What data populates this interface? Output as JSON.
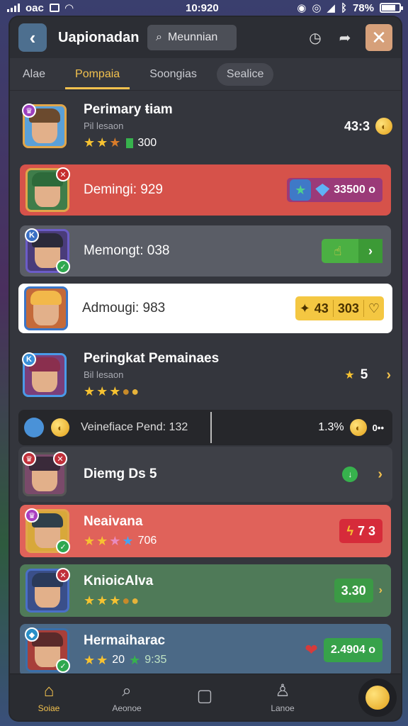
{
  "status_bar": {
    "carrier": "oac",
    "time": "10:920",
    "battery": "78%"
  },
  "header": {
    "title": "Uapionadan",
    "search_placeholder": "Meunnian"
  },
  "tabs": [
    "Alae",
    "Pompaia",
    "Soongias",
    "Sealice"
  ],
  "rows": [
    {
      "name": "Perimary ŧiam",
      "sub": "Pil lesaon",
      "value": "300",
      "right_value": "43:3",
      "rating": 3
    },
    {
      "name": "Demingi: 929",
      "right_value": "33500 o"
    },
    {
      "name": "Memongt: 038"
    },
    {
      "name": "Admougi: 983",
      "value_a": "43",
      "value_b": "303"
    },
    {
      "name": "Peringkat Pemainaes",
      "sub": "Bil lesaon",
      "right_value": "5"
    },
    {
      "name": "Veinefiace Pend: 132",
      "right_value": "1.3%",
      "tail": "0••"
    },
    {
      "name": "Diemg Ds 5"
    },
    {
      "name": "Neaivana",
      "value": "706",
      "right_value": "7 3"
    },
    {
      "name": "KnioicAlva",
      "right_value": "3.30"
    },
    {
      "name": "Hermaiharac",
      "value": "20",
      "value2": "9:35",
      "right_value": "2.4904 o"
    }
  ],
  "bottom_nav": [
    "Soiae",
    "Aeonoe",
    "",
    "Lanoe"
  ],
  "colors": {
    "accent": "#f2c14e",
    "panel": "#34363d",
    "red_row": "#d6524a",
    "green_row": "#4f7a58",
    "blue_row": "#4b6986"
  }
}
